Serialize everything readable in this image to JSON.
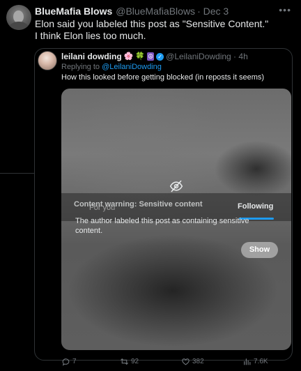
{
  "tweet": {
    "author_name": "BlueMafia Blows",
    "author_handle": "@BlueMafiaBlows",
    "date": "· Dec 3",
    "text_line1": "Elon said you labeled this post as \"Sensitive Content.\"",
    "text_line2": "I think Elon lies too much.",
    "more_icon": "more-icon"
  },
  "quote": {
    "author_name": "leilani dowding",
    "emojis": [
      "🌸",
      "🍀",
      "☮"
    ],
    "handle_time": "@LeilaniDowding · 4h",
    "reply_prefix": "Replying to ",
    "reply_handle": "@LeilaniDowding",
    "text": "How this looked before getting blocked (in reposts it seems)",
    "media": {
      "warning_title": "Content warning: Sensitive content",
      "ghost_tab": "For you",
      "following_tab": "Following",
      "warning_body": "The author labeled this post as containing sensitive content.",
      "show_label": "Show",
      "eye_icon": "eye-slash-icon"
    }
  },
  "actions": {
    "replies": "7",
    "reposts": "92",
    "likes": "382",
    "views": "7.6K"
  },
  "colors": {
    "background": "#000000",
    "accent": "#1d9bf0",
    "muted": "#71767b",
    "text": "#e7e9ea",
    "border": "#2f3336"
  }
}
